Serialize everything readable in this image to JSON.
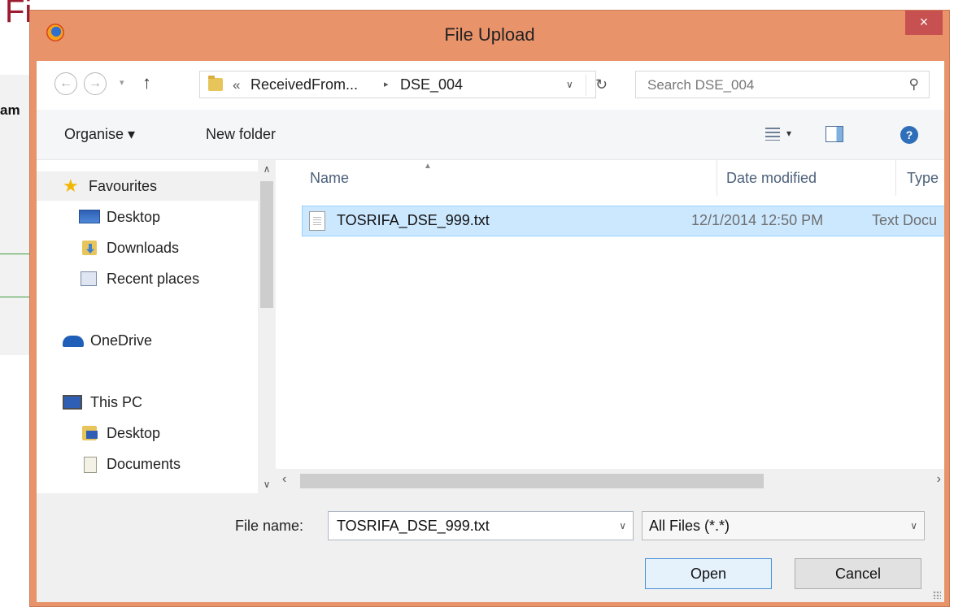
{
  "background": {
    "title_fragment": "Fi",
    "text_fragment": "am"
  },
  "window": {
    "title": "File Upload",
    "close_label": "×"
  },
  "nav": {
    "back": "←",
    "forward": "→",
    "up": "↑",
    "address": {
      "prefix": "«",
      "segment1": "ReceivedFrom...",
      "separator": "▸",
      "segment2": "DSE_004",
      "dropdown": "∨",
      "refresh": "↻"
    },
    "search_placeholder": "Search DSE_004",
    "search_icon": "⚲"
  },
  "toolbar": {
    "organise": "Organise ▾",
    "new_folder": "New folder",
    "views_dropdown": "▾",
    "help": "?"
  },
  "sidebar": {
    "items": [
      {
        "label": "Favourites",
        "icon": "star-icon"
      },
      {
        "label": "Desktop",
        "icon": "desktop-icon"
      },
      {
        "label": "Downloads",
        "icon": "downloads-icon"
      },
      {
        "label": "Recent places",
        "icon": "recent-icon"
      },
      {
        "label": "OneDrive",
        "icon": "onedrive-icon"
      },
      {
        "label": "This PC",
        "icon": "computer-icon"
      },
      {
        "label": "Desktop",
        "icon": "desktop-folder-icon"
      },
      {
        "label": "Documents",
        "icon": "documents-icon"
      }
    ]
  },
  "files": {
    "columns": [
      "Name",
      "Date modified",
      "Type"
    ],
    "rows": [
      {
        "name": "TOSRIFA_DSE_999.txt",
        "date": "12/1/2014 12:50 PM",
        "type": "Text Docu"
      }
    ]
  },
  "footer": {
    "file_name_label": "File name:",
    "file_name_value": "TOSRIFA_DSE_999.txt",
    "filter_value": "All Files (*.*)",
    "open_label": "Open",
    "cancel_label": "Cancel"
  },
  "colors": {
    "title_bar": "#e9936a",
    "close_button": "#c75050",
    "selection": "#cce8ff",
    "background_accent": "#9b1b30"
  }
}
